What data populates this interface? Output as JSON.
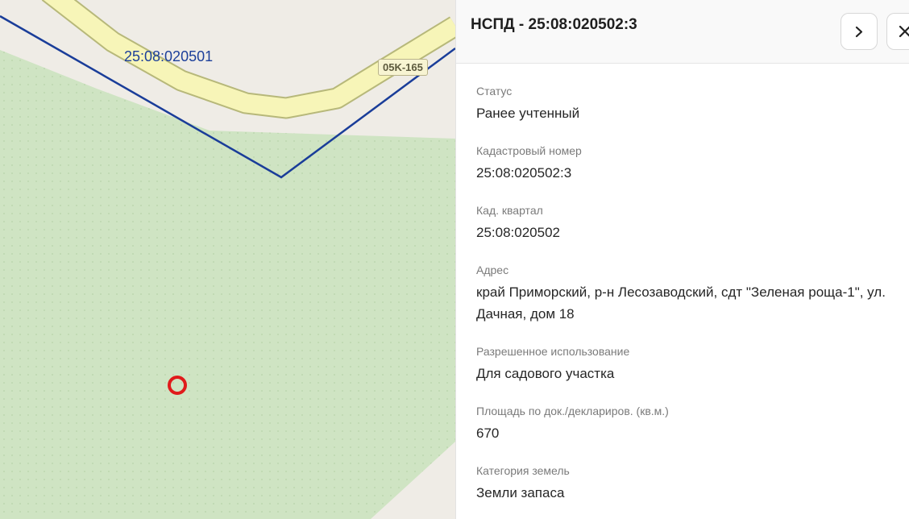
{
  "map": {
    "quarter_label": "25:08:020501",
    "road_label": "05K-165",
    "colors": {
      "background": "#efece6",
      "parcel_fill": "#cfe4c3",
      "road_fill": "#f7f5b8",
      "road_edge": "#b7b87a",
      "boundary": "#1a3d99",
      "marker": "#e01b1b"
    }
  },
  "panel": {
    "title": "НСПД - 25:08:020502:3",
    "next_icon": "chevron-right-icon",
    "close_icon": "close-icon",
    "fields": [
      {
        "label": "Статус",
        "value": "Ранее учтенный"
      },
      {
        "label": "Кадастровый номер",
        "value": "25:08:020502:3"
      },
      {
        "label": "Кад. квартал",
        "value": "25:08:020502"
      },
      {
        "label": "Адрес",
        "value": "край Приморский, р-н Лесозаводский, сдт \"Зеленая роща-1\", ул. Дачная, дом 18"
      },
      {
        "label": "Разрешенное использование",
        "value": "Для садового участка"
      },
      {
        "label": "Площадь по док./деклариров. (кв.м.)",
        "value": "670"
      },
      {
        "label": "Категория земель",
        "value": "Земли запаса"
      }
    ]
  }
}
